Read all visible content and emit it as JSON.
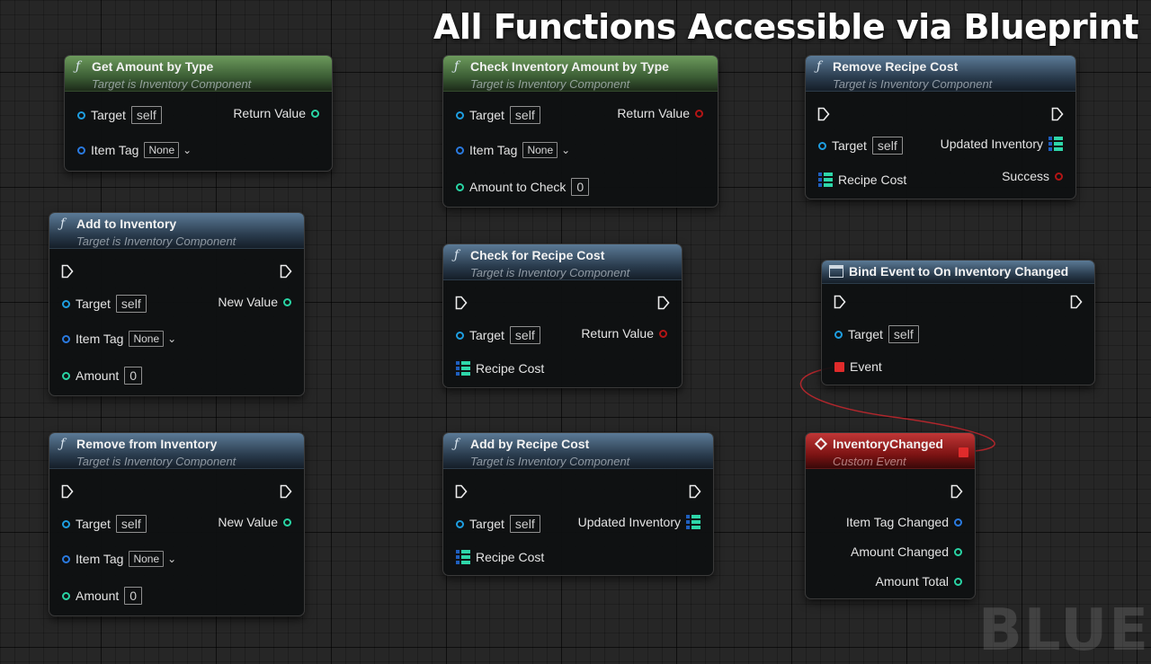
{
  "banner": "All Functions Accessible via Blueprint",
  "watermark": "BLUEF",
  "common": {
    "target_subtitle": "Target is Inventory Component",
    "target_label": "Target",
    "self_value": "self",
    "item_tag_label": "Item Tag",
    "none_value": "None",
    "amount_label": "Amount",
    "zero_value": "0",
    "recipe_cost_label": "Recipe Cost"
  },
  "nodes": {
    "get_amount": {
      "title": "Get Amount by Type",
      "return_label": "Return Value"
    },
    "check_inventory": {
      "title": "Check Inventory Amount by Type",
      "return_label": "Return Value",
      "amount_to_check_label": "Amount to Check"
    },
    "remove_recipe": {
      "title": "Remove Recipe Cost",
      "updated_label": "Updated Inventory",
      "success_label": "Success"
    },
    "add_inventory": {
      "title": "Add to Inventory",
      "new_value_label": "New Value"
    },
    "check_recipe": {
      "title": "Check for Recipe Cost",
      "return_label": "Return Value"
    },
    "bind_event": {
      "title": "Bind Event to On Inventory Changed",
      "event_label": "Event"
    },
    "remove_inventory": {
      "title": "Remove from Inventory",
      "new_value_label": "New Value"
    },
    "add_recipe": {
      "title": "Add by Recipe Cost",
      "updated_label": "Updated Inventory"
    },
    "inventory_changed": {
      "title": "InventoryChanged",
      "subtitle": "Custom Event",
      "item_tag_changed_label": "Item Tag Changed",
      "amount_changed_label": "Amount Changed",
      "amount_total_label": "Amount Total"
    }
  },
  "colors": {
    "function_header": "#2a3c4e",
    "pure_header": "#3b5c34",
    "event_header": "#7c1313",
    "object_pin": "#1e9ee0",
    "tag_pin": "#2a7ae0",
    "integer_pin": "#29d4a4",
    "boolean_pin": "#b31515",
    "delegate_pin": "#e02b2b",
    "wire": "#c0272d"
  },
  "icons": {
    "function": "function-icon",
    "delegate": "delegate-icon",
    "event": "event-icon",
    "exec": "exec-pin-icon",
    "array": "array-pin-icon"
  }
}
